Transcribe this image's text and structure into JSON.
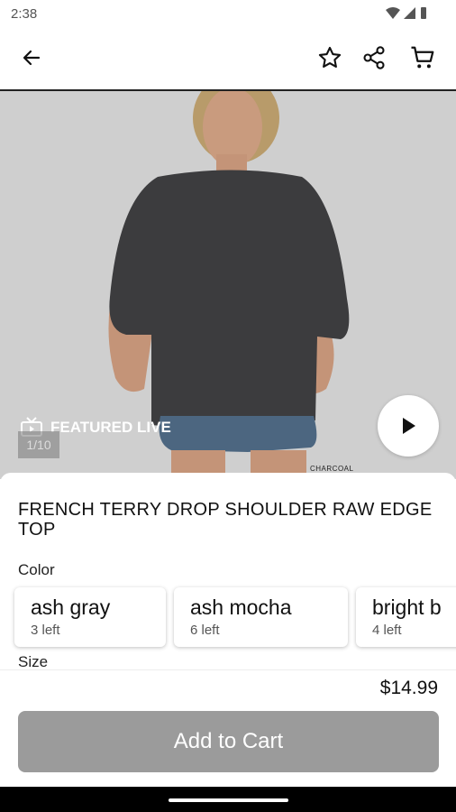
{
  "status_bar": {
    "time": "2:38",
    "icons": [
      "wifi-icon",
      "signal-icon",
      "battery-icon"
    ]
  },
  "top_bar": {
    "icons": [
      "back-arrow-icon",
      "star-icon",
      "share-icon",
      "cart-icon"
    ]
  },
  "hero": {
    "featured_label": "FEATURED LIVE",
    "image_counter": "1/10",
    "color_caption": "CHARCOAL"
  },
  "product": {
    "title": "FRENCH TERRY DROP SHOULDER RAW EDGE TOP",
    "color_label": "Color",
    "size_label": "Size",
    "colors": [
      {
        "name": "ash gray",
        "stock": "3 left"
      },
      {
        "name": "ash mocha",
        "stock": "6 left"
      },
      {
        "name": "bright b",
        "stock": "4 left"
      }
    ],
    "price": "$14.99",
    "add_to_cart": "Add to Cart"
  },
  "colors": {
    "accent_button": "#9b9b9b",
    "hero_background": "#cfcfcf"
  }
}
